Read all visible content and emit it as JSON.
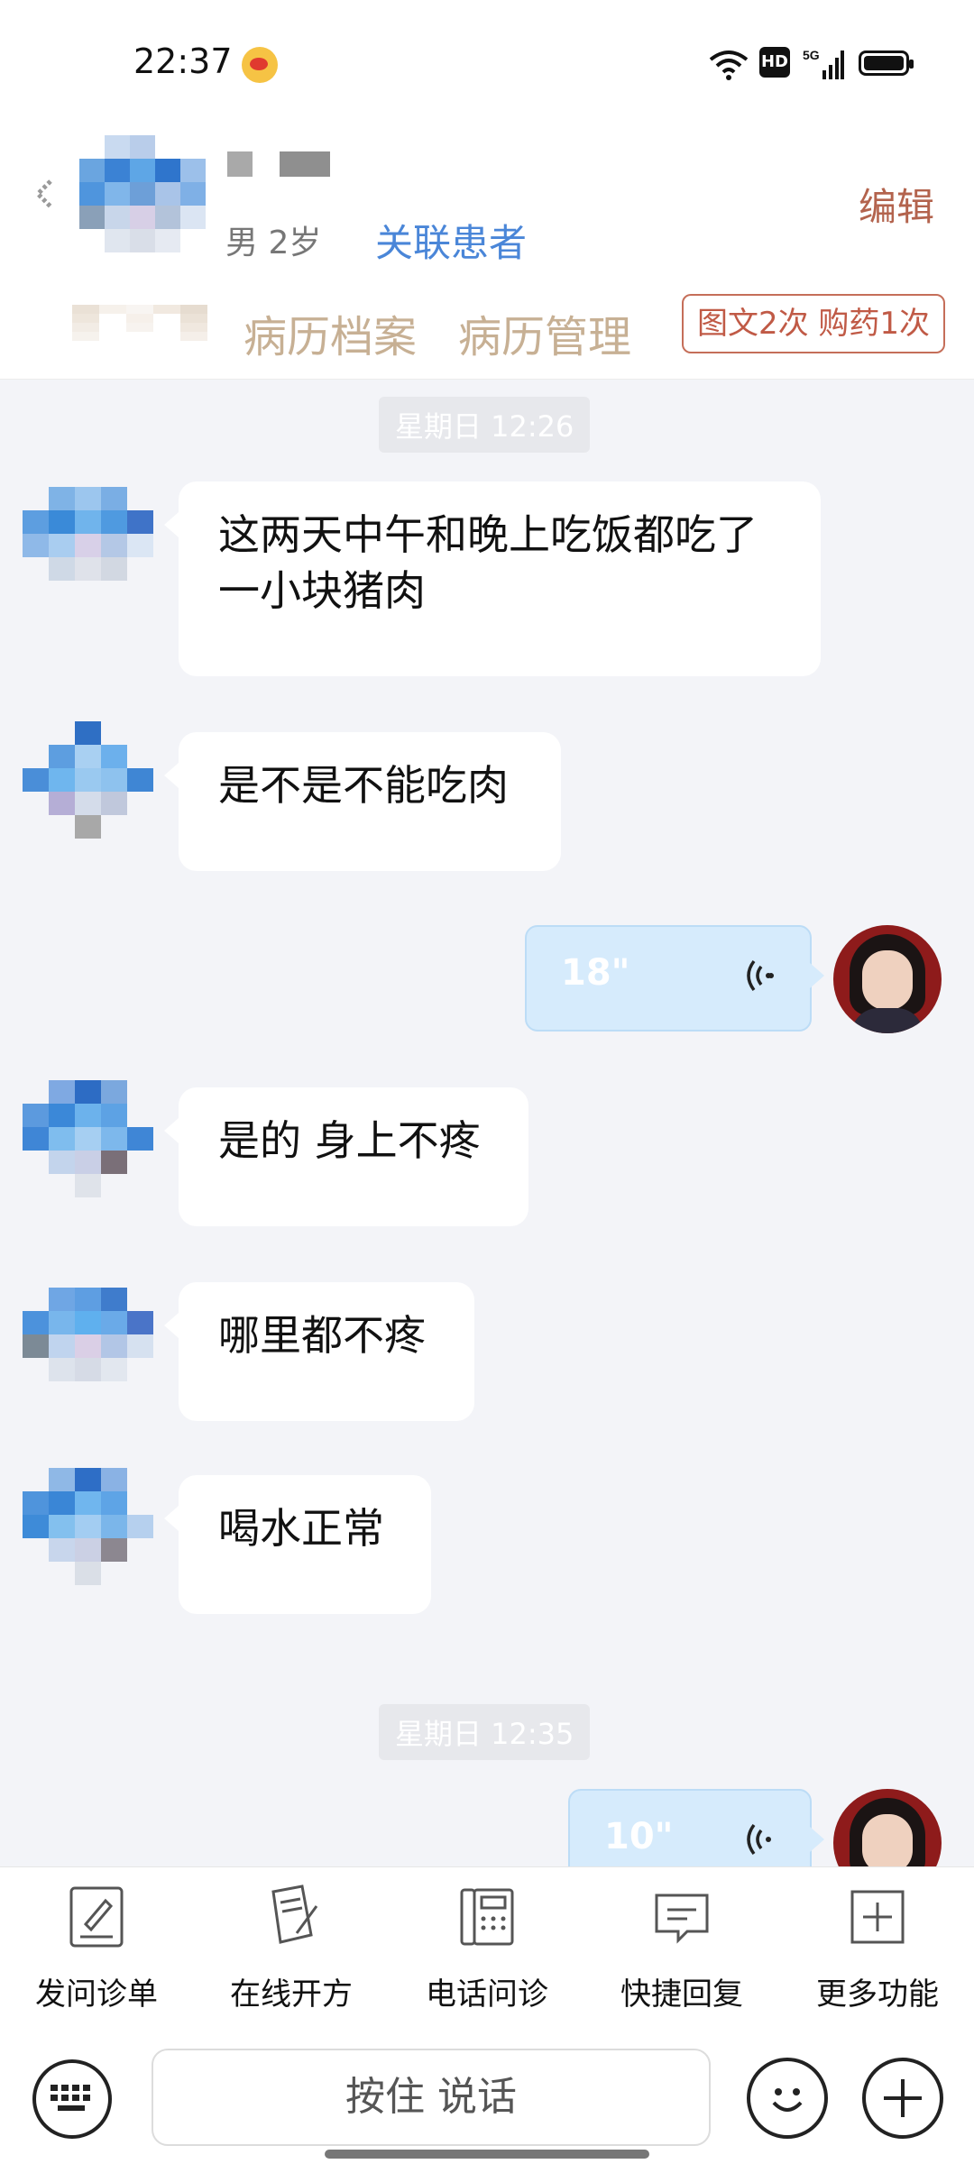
{
  "status_bar": {
    "time": "22:37",
    "network": "5G"
  },
  "header": {
    "patient_info": "男 2岁",
    "link_patient": "关联患者",
    "edit": "编辑",
    "tabs": [
      "病历档案",
      "病历管理"
    ],
    "service_badge": "图文2次 购药1次"
  },
  "chat": {
    "time_chips": [
      "星期日 12:26",
      "星期日 12:35"
    ],
    "messages": [
      "这两天中午和晚上吃饭都吃了一小块猪肉",
      "是不是不能吃肉",
      "是的 身上不疼",
      "哪里都不疼",
      "喝水正常"
    ],
    "voice": [
      "18\"",
      "10\""
    ]
  },
  "toolbar": {
    "items": [
      "发问诊单",
      "在线开方",
      "电话问诊",
      "快捷回复",
      "更多功能"
    ]
  },
  "input_bar": {
    "hold_to_talk": "按住 说话"
  }
}
